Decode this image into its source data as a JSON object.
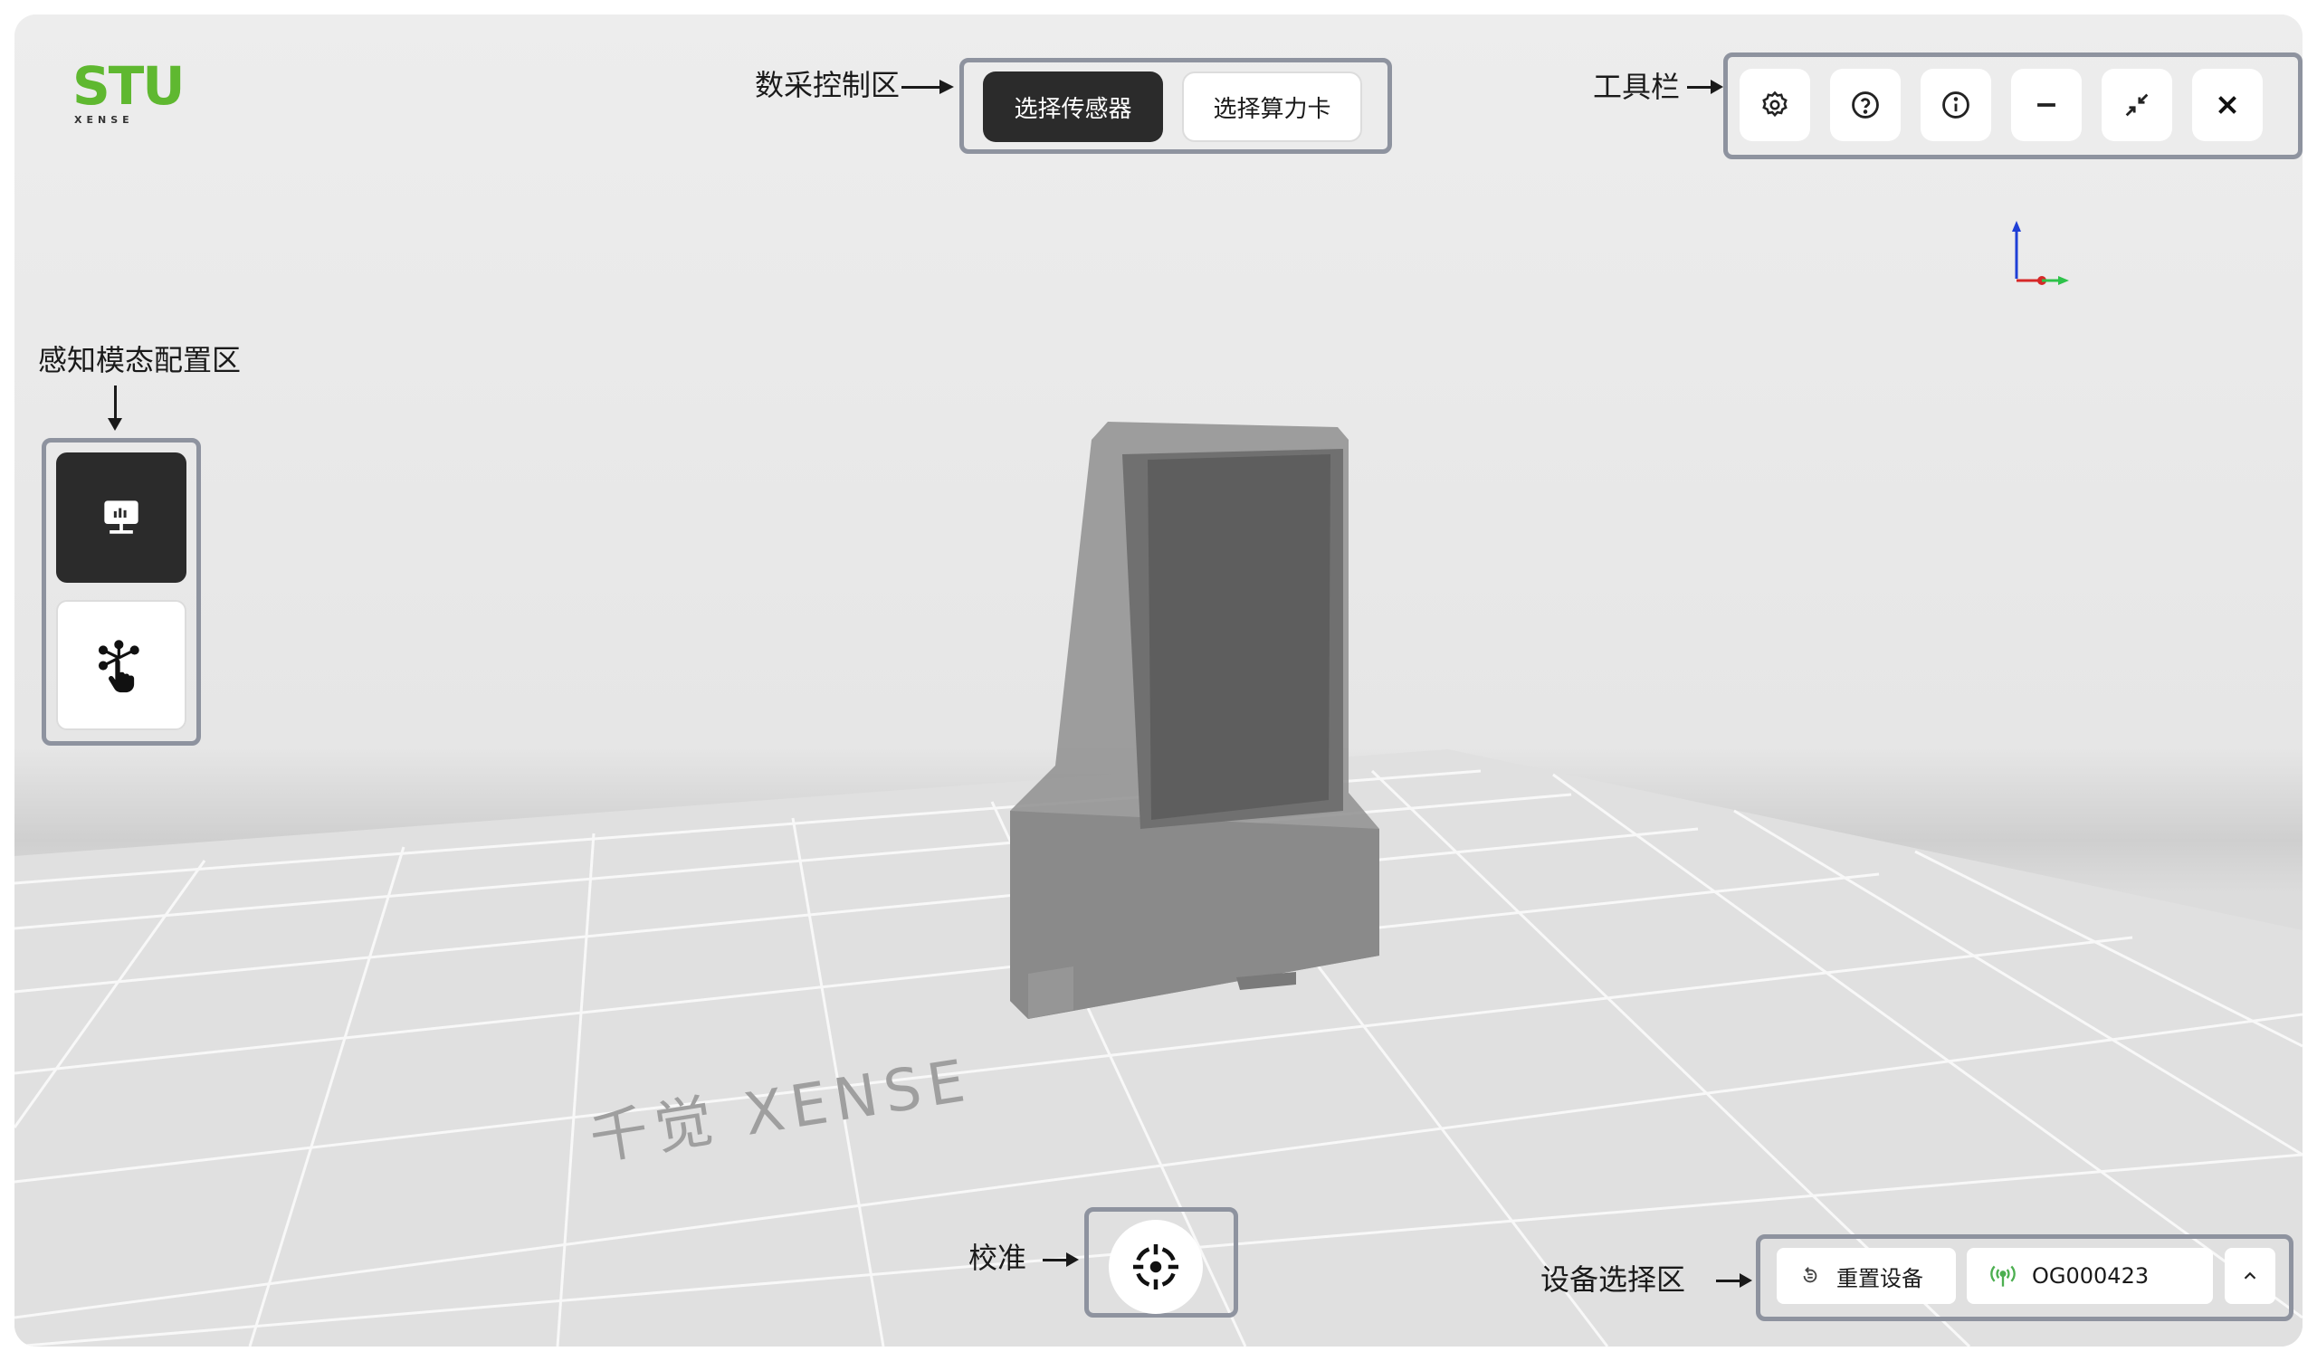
{
  "logo": {
    "brand": "STU",
    "subtext": "XENSE"
  },
  "floor_watermark": "千觉 XENSE",
  "data_control": {
    "annotation": "数采控制区",
    "select_sensor_label": "选择传感器",
    "select_card_label": "选择算力卡"
  },
  "toolbar": {
    "annotation": "工具栏",
    "buttons": [
      "gear-icon",
      "help-icon",
      "info-icon",
      "minimize-icon",
      "restore-icon",
      "close-icon"
    ]
  },
  "perception": {
    "annotation": "感知模态配置区",
    "modes": [
      "visual-monitor-icon",
      "tactile-touch-icon"
    ]
  },
  "calibrate": {
    "annotation": "校准"
  },
  "device_select": {
    "annotation": "设备选择区",
    "reset_label": "重置设备",
    "device_id": "OG000423"
  },
  "colors": {
    "accent_dark": "#2b2b2b",
    "brand_green": "#5fb830",
    "signal_green": "#4caf50",
    "annotation_border": "#8e939f",
    "axis_x": "#d62828",
    "axis_y": "#2ec24a",
    "axis_z": "#1f3fd6"
  }
}
